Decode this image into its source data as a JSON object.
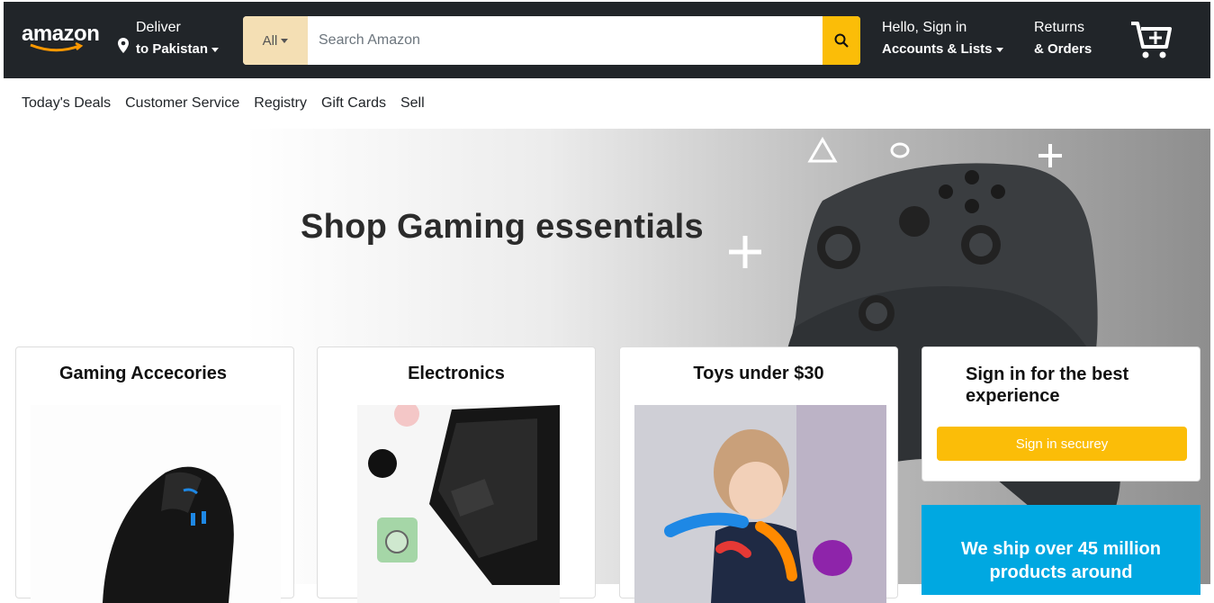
{
  "header": {
    "logo_text": "amazon",
    "deliver_line1": "Deliver",
    "deliver_line2": "to Pakistan",
    "search_category": "All",
    "search_placeholder": "Search Amazon",
    "account_line1": "Hello, Sign in",
    "account_line2": "Accounts & Lists",
    "returns_line1": "Returns",
    "returns_line2": "& Orders"
  },
  "subnav": {
    "items": [
      "Today's Deals",
      "Customer Service",
      "Registry",
      "Gift Cards",
      "Sell"
    ]
  },
  "hero": {
    "title": "Shop Gaming essentials"
  },
  "cards": [
    {
      "title": "Gaming Accecories"
    },
    {
      "title": "Electronics"
    },
    {
      "title": "Toys under $30"
    }
  ],
  "signin_card": {
    "title": "Sign in for the best experience",
    "button_label": "Sign in securey"
  },
  "ship_banner": {
    "text": "We ship over 45 million products around"
  },
  "colors": {
    "nav_bg": "#212529",
    "accent": "#fbbd08",
    "search_category_bg": "#f4dfb4",
    "ship_banner_bg": "#00a8e1"
  }
}
